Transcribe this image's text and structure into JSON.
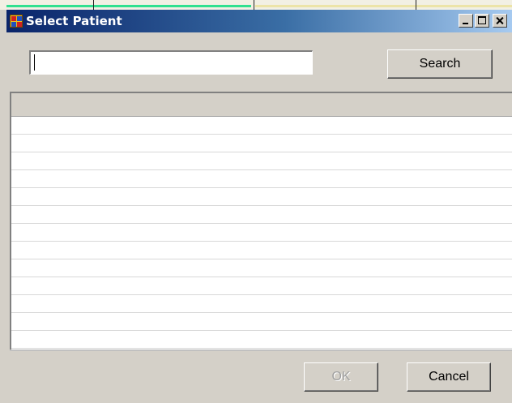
{
  "window": {
    "title": "Select Patient"
  },
  "search": {
    "value": "",
    "button_label": "Search"
  },
  "grid": {
    "columns": [],
    "rows": [
      "",
      "",
      "",
      "",
      "",
      "",
      "",
      "",
      "",
      "",
      "",
      "",
      ""
    ]
  },
  "footer": {
    "ok_label": "OK",
    "ok_enabled": false,
    "cancel_label": "Cancel"
  },
  "colors": {
    "titlebar_start": "#0a246a",
    "titlebar_end": "#a6caf0",
    "dialog_bg": "#d4d0c8"
  },
  "icons": {
    "app": "app-window-icon",
    "minimize": "minimize-icon",
    "maximize": "maximize-icon",
    "close": "close-icon"
  }
}
